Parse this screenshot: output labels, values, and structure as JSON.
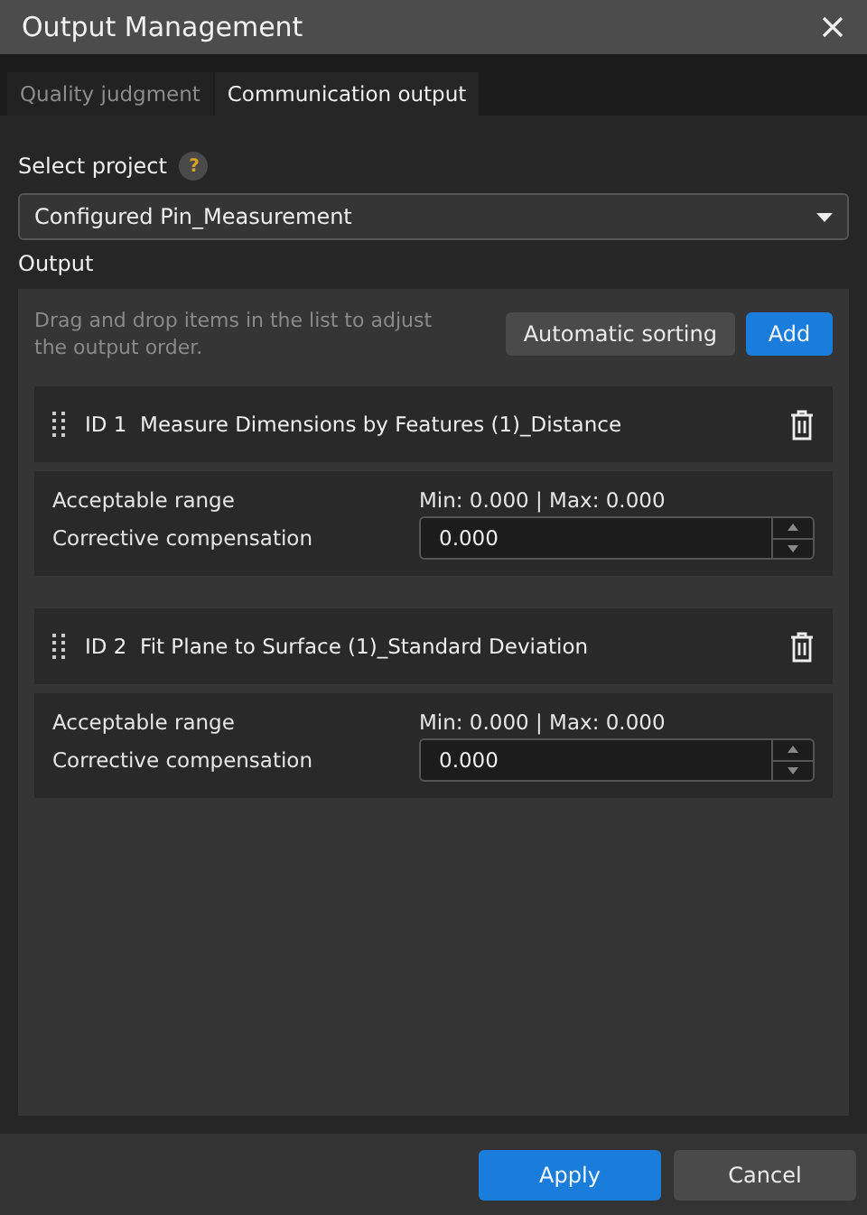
{
  "window": {
    "title": "Output Management"
  },
  "tabs": [
    {
      "label": "Quality judgment",
      "selected": false
    },
    {
      "label": "Communication output",
      "selected": true
    }
  ],
  "select_project": {
    "label": "Select project",
    "help": "?",
    "value": "Configured Pin_Measurement"
  },
  "output": {
    "label": "Output",
    "hint": "Drag and drop items in the list to adjust the output order.",
    "buttons": [
      {
        "label": "Automatic sorting",
        "kind": "secondary"
      },
      {
        "label": "Add",
        "kind": "primary"
      }
    ],
    "items": [
      {
        "id": "ID 1",
        "name": "Measure Dimensions by Features (1)_Distance",
        "range_label": "Acceptable range",
        "range": "Min: 0.000 | Max: 0.000",
        "compensation_label": "Corrective compensation",
        "compensation": "0.000"
      },
      {
        "id": "ID 2",
        "name": "Fit Plane to Surface (1)_Standard Deviation",
        "range_label": "Acceptable range",
        "range": "Min: 0.000 | Max: 0.000",
        "compensation_label": "Corrective compensation",
        "compensation": "0.000"
      }
    ]
  },
  "footer": {
    "buttons": [
      {
        "label": "Apply",
        "kind": "primary"
      },
      {
        "label": "Cancel",
        "kind": "secondary"
      }
    ]
  }
}
